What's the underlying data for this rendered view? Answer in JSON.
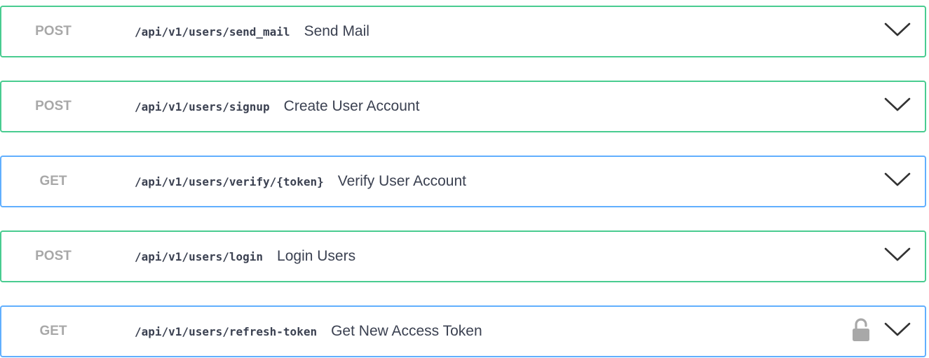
{
  "operations": [
    {
      "method": "POST",
      "path": "/api/v1/users/send_mail",
      "summary": "Send Mail",
      "border_color": "#49cc90",
      "icons": [
        "chevron-down-icon"
      ]
    },
    {
      "method": "POST",
      "path": "/api/v1/users/signup",
      "summary": "Create User Account",
      "border_color": "#49cc90",
      "icons": [
        "chevron-down-icon"
      ]
    },
    {
      "method": "GET",
      "path": "/api/v1/users/verify/{token}",
      "summary": "Verify User Account",
      "border_color": "#61affe",
      "icons": [
        "chevron-down-icon"
      ]
    },
    {
      "method": "POST",
      "path": "/api/v1/users/login",
      "summary": "Login Users",
      "border_color": "#49cc90",
      "icons": [
        "chevron-down-icon"
      ]
    },
    {
      "method": "GET",
      "path": "/api/v1/users/refresh-token",
      "summary": "Get New Access Token",
      "border_color": "#61affe",
      "icons": [
        "unlocked-padlock-icon",
        "chevron-down-icon"
      ]
    }
  ],
  "colors": {
    "method_text": "#a8a8a8",
    "text": "#3b4151",
    "post_border": "#49cc90",
    "get_border": "#61affe",
    "icon": "#333333",
    "lock": "#a8a8a8"
  }
}
